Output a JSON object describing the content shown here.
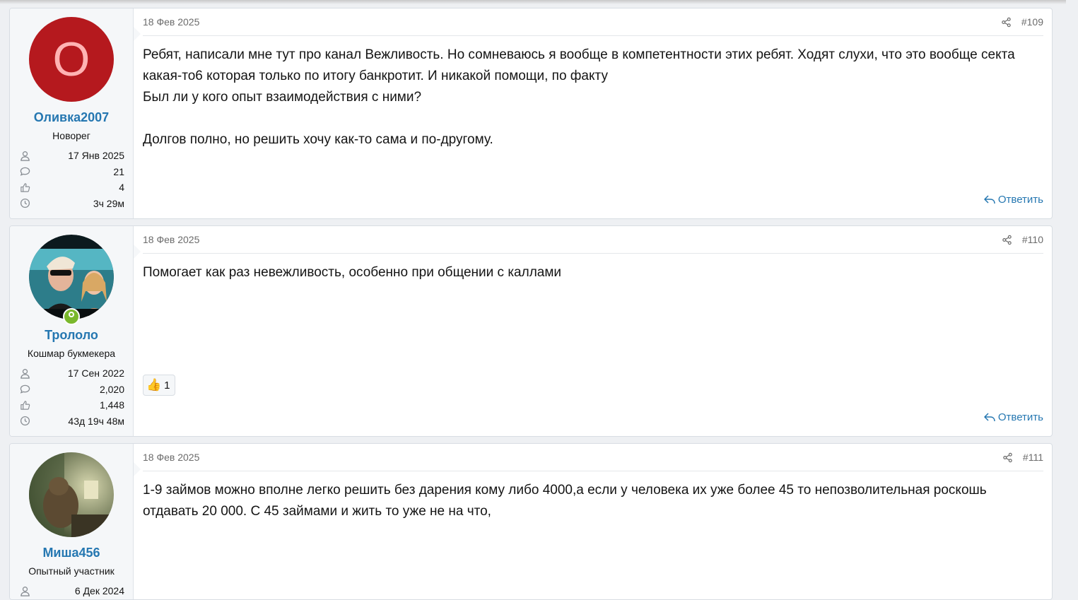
{
  "reply_label": "Ответить",
  "posts": [
    {
      "date": "18 Фев 2025",
      "number": "#109",
      "avatar_letter": "О",
      "username": "Оливка2007",
      "user_title": "Новорег",
      "joined": "17 Янв 2025",
      "messages": "21",
      "reactions": "4",
      "time_online": "3ч 29м",
      "body": "Ребят, написали мне тут про канал Вежливость. Но сомневаюсь я вообще в компетентности этих ребят. Ходят слухи, что это вообще секта какая-то6 которая только по итогу банкротит. И никакой помощи, по факту\nБыл ли у кого опыт взаимодействия с ними?\n\nДолгов полно, но решить хочу как-то сама и по-другому."
    },
    {
      "date": "18 Фев 2025",
      "number": "#110",
      "username": "Трололо",
      "user_title": "Кошмар букмекера",
      "joined": "17 Сен 2022",
      "messages": "2,020",
      "reactions": "1,448",
      "time_online": "43д 19ч 48м",
      "body": "Помогает как раз невежливость, особенно при общении с каллами",
      "reaction_count": "1"
    },
    {
      "date": "18 Фев 2025",
      "number": "#111",
      "username": "Миша456",
      "user_title": "Опытный участник",
      "joined": "6 Дек 2024",
      "body": "1-9 займов можно вполне легко решить без дарения кому либо 4000,а если у человека их уже более 45 то непозволительная роскошь отдавать 20 000. С 45 займами и жить то уже не на что,"
    }
  ]
}
